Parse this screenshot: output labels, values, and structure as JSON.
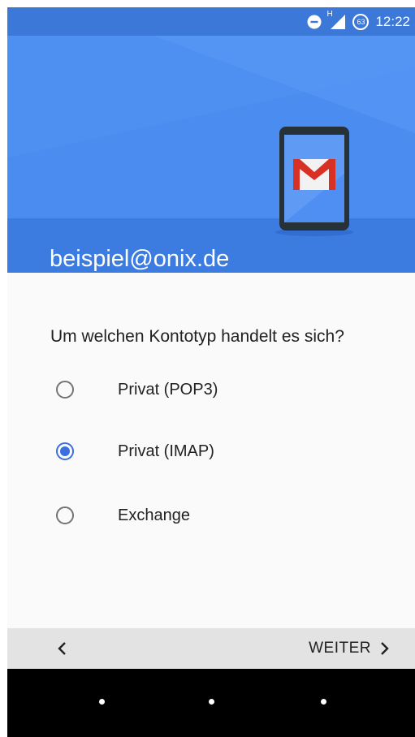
{
  "status_bar": {
    "time": "12:22",
    "network_label": "H",
    "badge_number": "63",
    "icons": [
      "dnd-icon",
      "signal-icon",
      "notification-badge-icon"
    ]
  },
  "header": {
    "account": "beispiel@onix.de",
    "illustration": "gmail-phone-icon"
  },
  "form": {
    "question": "Um welchen Kontotyp handelt es sich?",
    "options": [
      {
        "label": "Privat (POP3)",
        "selected": false
      },
      {
        "label": "Privat (IMAP)",
        "selected": true
      },
      {
        "label": "Exchange",
        "selected": false
      }
    ]
  },
  "footer": {
    "back_icon": "chevron-left-icon",
    "next_label": "WEITER",
    "next_icon": "chevron-right-icon"
  },
  "navigation_bar": {
    "icons": [
      "nav-back-icon",
      "nav-home-icon",
      "nav-recents-icon"
    ]
  },
  "colors": {
    "status_bar": "#3b78d8",
    "header_bg": "#4a8cf0",
    "header_band": "#3c7be0",
    "accent": "#3b6fe0",
    "content_bg": "#fafafa",
    "footer_bg": "#e3e3e3",
    "nav_bg": "#000000"
  }
}
